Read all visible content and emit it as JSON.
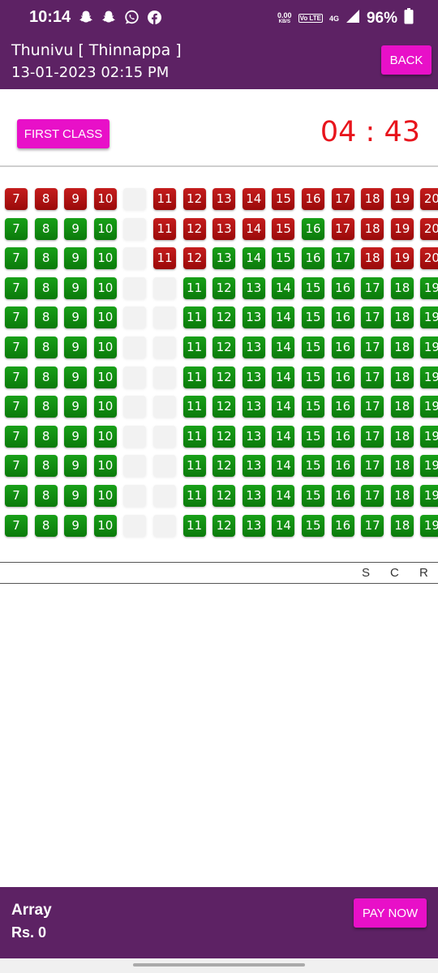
{
  "status_bar": {
    "time": "10:14",
    "notification_icons": [
      "snapchat-icon",
      "snapchat-icon",
      "whatsapp-icon",
      "facebook-icon"
    ],
    "net_speed_value": "0.00",
    "net_speed_unit": "KB/S",
    "volte_label": "Vo LTE",
    "network_label": "4G",
    "battery": "96%"
  },
  "header": {
    "title": "Thunivu [ Thinnappa ]",
    "datetime": "13-01-2023 02:15 PM",
    "back_label": "BACK"
  },
  "class_button": "FIRST CLASS",
  "timer": "04 : 43",
  "rows": [
    {
      "left": [
        7,
        8,
        9,
        10
      ],
      "left_status": [
        "sold",
        "sold",
        "sold",
        "sold"
      ],
      "right": [
        11,
        12,
        13,
        14,
        15,
        16,
        17,
        18,
        19,
        20
      ],
      "right_status": [
        "sold",
        "sold",
        "sold",
        "sold",
        "sold",
        "sold",
        "sold",
        "sold",
        "sold",
        "sold"
      ]
    },
    {
      "left": [
        7,
        8,
        9,
        10
      ],
      "left_status": [
        "available",
        "available",
        "available",
        "available"
      ],
      "right": [
        11,
        12,
        13,
        14,
        15,
        16,
        17,
        18,
        19,
        20
      ],
      "right_status": [
        "sold",
        "sold",
        "sold",
        "sold",
        "sold",
        "available",
        "sold",
        "sold",
        "sold",
        "sold"
      ]
    },
    {
      "left": [
        7,
        8,
        9,
        10
      ],
      "left_status": [
        "available",
        "available",
        "available",
        "available"
      ],
      "right": [
        11,
        12,
        13,
        14,
        15,
        16,
        17,
        18,
        19,
        20
      ],
      "right_status": [
        "sold",
        "sold",
        "available",
        "available",
        "available",
        "available",
        "available",
        "sold",
        "sold",
        "sold"
      ]
    },
    {
      "left": [
        7,
        8,
        9,
        10
      ],
      "left_status": [
        "available",
        "available",
        "available",
        "available"
      ],
      "right": [
        11,
        12,
        13,
        14,
        15,
        16,
        17,
        18,
        19
      ],
      "right_status": [
        "available",
        "available",
        "available",
        "available",
        "available",
        "available",
        "available",
        "available",
        "available"
      ]
    },
    {
      "left": [
        7,
        8,
        9,
        10
      ],
      "left_status": [
        "available",
        "available",
        "available",
        "available"
      ],
      "right": [
        11,
        12,
        13,
        14,
        15,
        16,
        17,
        18,
        19
      ],
      "right_status": [
        "available",
        "available",
        "available",
        "available",
        "available",
        "available",
        "available",
        "available",
        "available"
      ]
    },
    {
      "left": [
        7,
        8,
        9,
        10
      ],
      "left_status": [
        "available",
        "available",
        "available",
        "available"
      ],
      "right": [
        11,
        12,
        13,
        14,
        15,
        16,
        17,
        18,
        19
      ],
      "right_status": [
        "available",
        "available",
        "available",
        "available",
        "available",
        "available",
        "available",
        "available",
        "available"
      ]
    },
    {
      "left": [
        7,
        8,
        9,
        10
      ],
      "left_status": [
        "available",
        "available",
        "available",
        "available"
      ],
      "right": [
        11,
        12,
        13,
        14,
        15,
        16,
        17,
        18,
        19
      ],
      "right_status": [
        "available",
        "available",
        "available",
        "available",
        "available",
        "available",
        "available",
        "available",
        "available"
      ]
    },
    {
      "left": [
        7,
        8,
        9,
        10
      ],
      "left_status": [
        "available",
        "available",
        "available",
        "available"
      ],
      "right": [
        11,
        12,
        13,
        14,
        15,
        16,
        17,
        18,
        19
      ],
      "right_status": [
        "available",
        "available",
        "available",
        "available",
        "available",
        "available",
        "available",
        "available",
        "available"
      ]
    },
    {
      "left": [
        7,
        8,
        9,
        10
      ],
      "left_status": [
        "available",
        "available",
        "available",
        "available"
      ],
      "right": [
        11,
        12,
        13,
        14,
        15,
        16,
        17,
        18,
        19
      ],
      "right_status": [
        "available",
        "available",
        "available",
        "available",
        "available",
        "available",
        "available",
        "available",
        "available"
      ]
    },
    {
      "left": [
        7,
        8,
        9,
        10
      ],
      "left_status": [
        "available",
        "available",
        "available",
        "available"
      ],
      "right": [
        11,
        12,
        13,
        14,
        15,
        16,
        17,
        18,
        19
      ],
      "right_status": [
        "available",
        "available",
        "available",
        "available",
        "available",
        "available",
        "available",
        "available",
        "available"
      ]
    },
    {
      "left": [
        7,
        8,
        9,
        10
      ],
      "left_status": [
        "available",
        "available",
        "available",
        "available"
      ],
      "right": [
        11,
        12,
        13,
        14,
        15,
        16,
        17,
        18,
        19
      ],
      "right_status": [
        "available",
        "available",
        "available",
        "available",
        "available",
        "available",
        "available",
        "available",
        "available"
      ]
    },
    {
      "left": [
        7,
        8,
        9,
        10
      ],
      "left_status": [
        "available",
        "available",
        "available",
        "available"
      ],
      "right": [
        11,
        12,
        13,
        14,
        15,
        16,
        17,
        18,
        19
      ],
      "right_status": [
        "available",
        "available",
        "available",
        "available",
        "available",
        "available",
        "available",
        "available",
        "available"
      ]
    }
  ],
  "screen_letters": [
    "S",
    "C",
    "R"
  ],
  "footer": {
    "name": "Array",
    "amount": "Rs. 0",
    "pay_label": "PAY NOW"
  },
  "colors": {
    "brand_purple": "#5d2264",
    "button_magenta": "#e810c8",
    "seat_sold": "#b01414",
    "seat_available": "#118c11",
    "timer_red": "#e8141c"
  }
}
